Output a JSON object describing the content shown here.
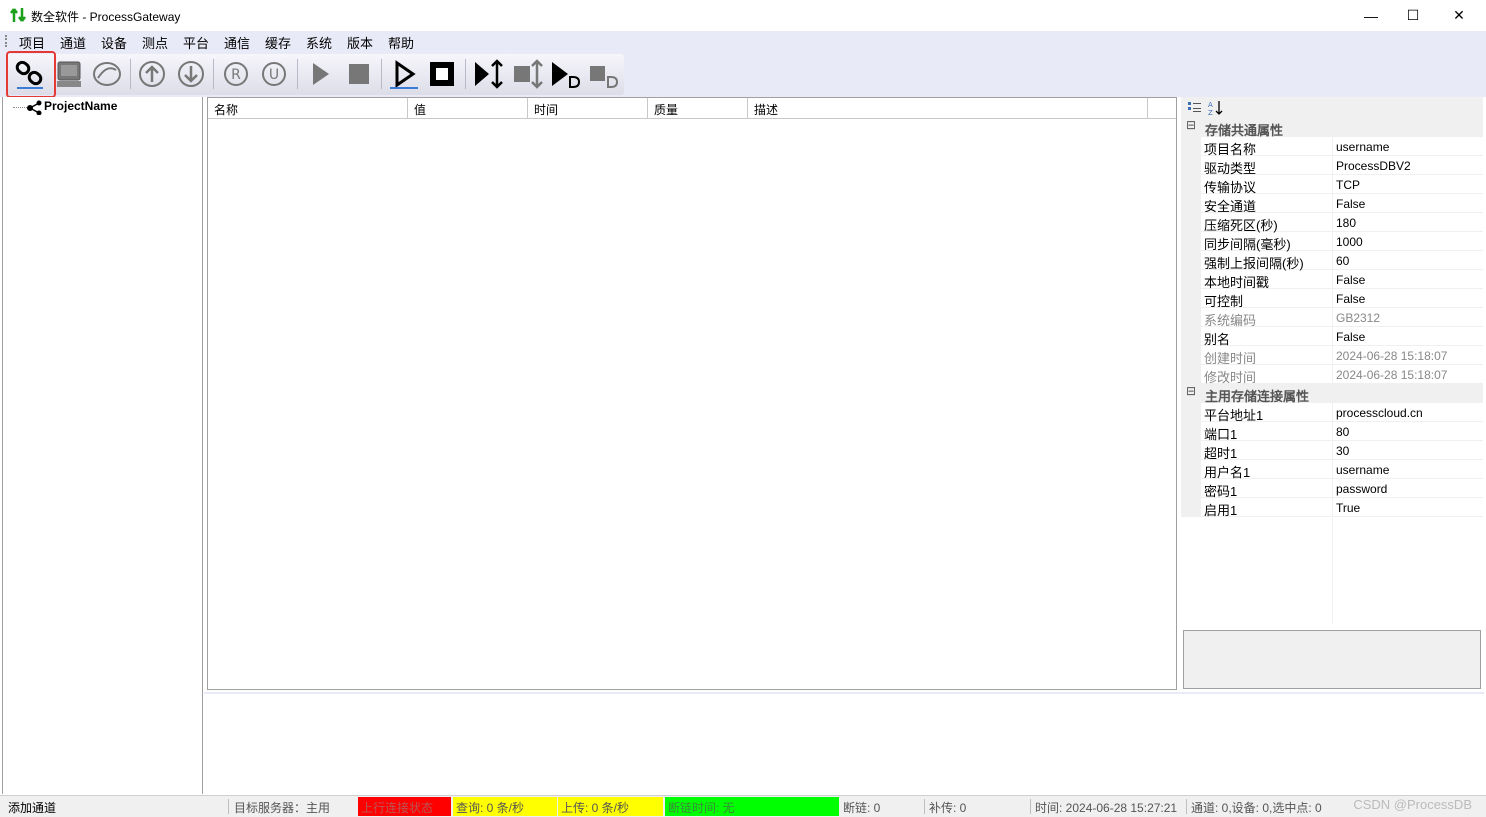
{
  "window": {
    "title": "数全软件 - ProcessGateway",
    "minimize": "—",
    "maximize": "☐",
    "close": "✕"
  },
  "menu": [
    "项目",
    "通道",
    "设备",
    "测点",
    "平台",
    "通信",
    "缓存",
    "系统",
    "版本",
    "帮助"
  ],
  "toolbar": {
    "buttons": [
      "connect-icon",
      "device-icon",
      "sync-icon",
      "upload-icon",
      "download-icon",
      "registered-icon",
      "update-icon",
      "play-gray-icon",
      "stop-gray-icon",
      "play-icon",
      "stop-icon",
      "play-transfer-icon",
      "stop-transfer-icon",
      "play-data-icon",
      "stop-data-icon"
    ]
  },
  "tree": {
    "root": "ProjectName"
  },
  "grid": {
    "columns": [
      "名称",
      "值",
      "时间",
      "质量",
      "描述"
    ]
  },
  "properties": {
    "categories": [
      {
        "label": "存储共通属性",
        "rows": [
          {
            "name": "项目名称",
            "value": "username"
          },
          {
            "name": "驱动类型",
            "value": "ProcessDBV2"
          },
          {
            "name": "传输协议",
            "value": "TCP"
          },
          {
            "name": "安全通道",
            "value": "False"
          },
          {
            "name": "压缩死区(秒)",
            "value": "180"
          },
          {
            "name": "同步间隔(毫秒)",
            "value": "1000"
          },
          {
            "name": "强制上报间隔(秒)",
            "value": "60"
          },
          {
            "name": "本地时间戳",
            "value": "False"
          },
          {
            "name": "可控制",
            "value": "False"
          },
          {
            "name": "系统编码",
            "value": "GB2312",
            "dim": true
          },
          {
            "name": "别名",
            "value": "False"
          },
          {
            "name": "创建时间",
            "value": "2024-06-28 15:18:07",
            "dim": true
          },
          {
            "name": "修改时间",
            "value": "2024-06-28 15:18:07",
            "dim": true
          }
        ]
      },
      {
        "label": "主用存储连接属性",
        "rows": [
          {
            "name": "平台地址1",
            "value": "processcloud.cn"
          },
          {
            "name": "端口1",
            "value": "80"
          },
          {
            "name": "超时1",
            "value": "30"
          },
          {
            "name": "用户名1",
            "value": "username"
          },
          {
            "name": "密码1",
            "value": "password"
          },
          {
            "name": "启用1",
            "value": "True"
          }
        ]
      }
    ]
  },
  "status": {
    "action": "添加通道",
    "target_server": "目标服务器：主用",
    "upstream": "上行连接状态",
    "query": "查询:    0 条/秒",
    "upload": "上传:    0 条/秒",
    "disconnect_time": "断链时间: 无",
    "disconnect": "断链: 0",
    "resend": "补传: 0",
    "time": "时间: 2024-06-28 15:27:21",
    "counts": "通道: 0,设备: 0,选中点: 0",
    "watermark": "CSDN @ProcessDB",
    "colors": {
      "upstream": "#ff0000",
      "query": "#ffff00",
      "upload": "#ffff00",
      "disconnect_time": "#00ff00"
    }
  }
}
